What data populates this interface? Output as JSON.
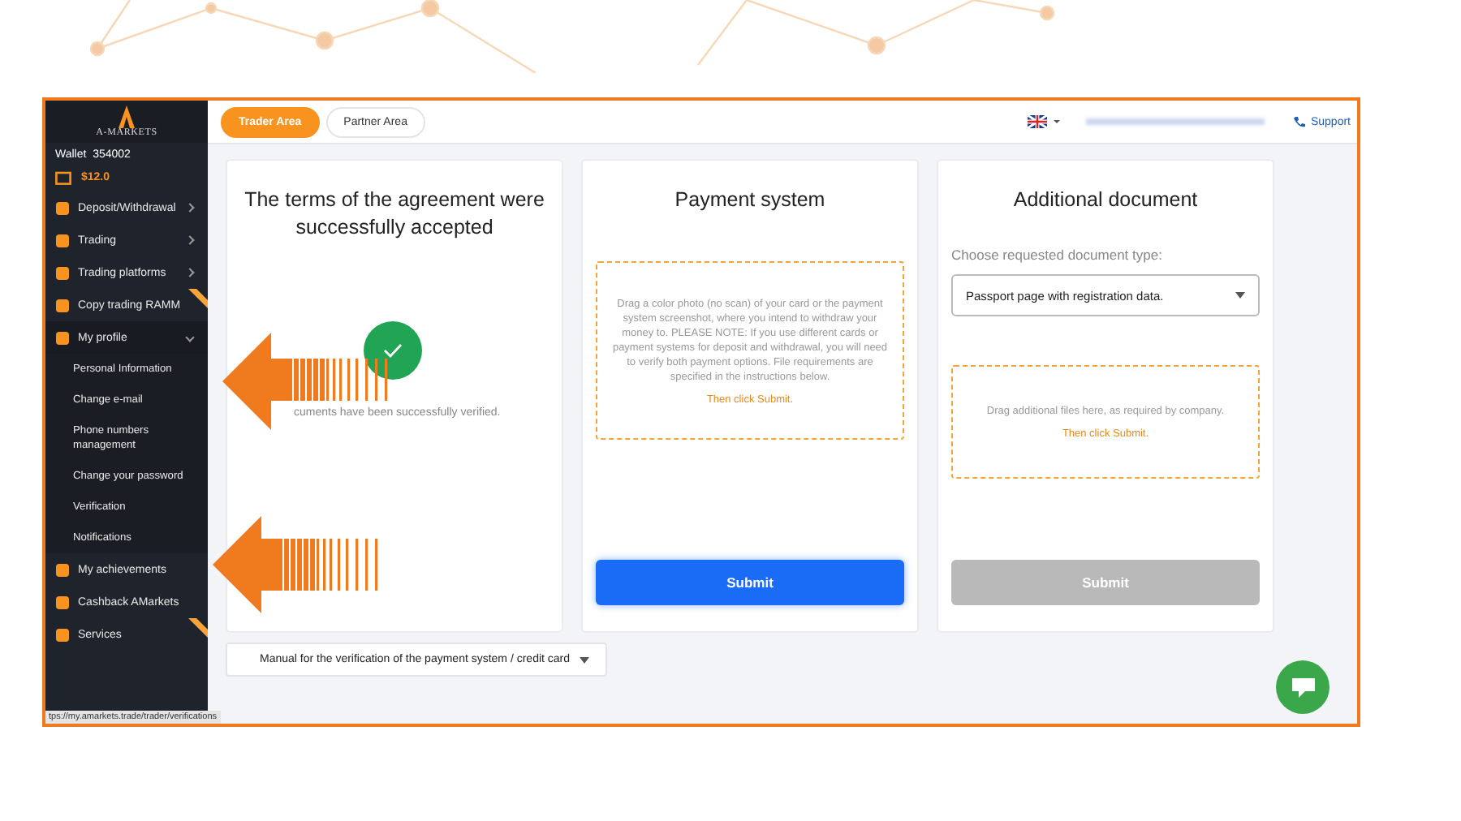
{
  "sidebar": {
    "logo": "A-MARKETS",
    "wallet": "Wallet  354002",
    "balance": "$12.0",
    "items": [
      {
        "label": "Deposit/Withdrawal",
        "kind": "group",
        "expanded": false
      },
      {
        "label": "Trading",
        "kind": "group",
        "expanded": false
      },
      {
        "label": "Trading platforms",
        "kind": "group",
        "expanded": false
      },
      {
        "label": "Copy trading RAMM",
        "kind": "link",
        "badge": true
      },
      {
        "label": "My profile",
        "kind": "group",
        "expanded": true,
        "children": [
          {
            "label": "Personal Information"
          },
          {
            "label": "Change e-mail"
          },
          {
            "label": "Phone numbers management"
          },
          {
            "label": "Change your password"
          },
          {
            "label": "Verification"
          },
          {
            "label": "Notifications"
          }
        ]
      },
      {
        "label": "My achievements",
        "kind": "link"
      },
      {
        "label": "Cashback AMarkets",
        "kind": "link"
      },
      {
        "label": "Services",
        "kind": "link",
        "badge": true
      }
    ]
  },
  "tabs": [
    {
      "label": "Trader Area",
      "selected": true
    },
    {
      "label": "Partner Area",
      "selected": false
    }
  ],
  "support": "Support",
  "cards": [
    {
      "title": "The terms of the agreement were successfully accepted",
      "kind": "status",
      "message": "cuments have been successfully verified."
    },
    {
      "title": "Payment system",
      "kind": "upload",
      "dropzone": "Drag a color photo (no scan) of your card or the payment system screenshot, where you intend to withdraw your money to. PLEASE NOTE: If you use different cards or payment systems for deposit and withdrawal, you will need to verify both payment options. File requirements are specified in the instructions below.",
      "action": "Then click Submit.",
      "submit": "Submit",
      "disabled": false
    },
    {
      "title": "Additional document",
      "kind": "upload",
      "label": "Choose requested document type:",
      "select": "Passport page with registration data.",
      "dropzone": "Drag additional files here, as required by company.",
      "action": "Then click Submit.",
      "submit": "Submit",
      "disabled": true
    }
  ],
  "manual": "Manual for the verification of the payment system / credit card",
  "status_url": "tps://my.amarkets.trade/trader/verifications"
}
